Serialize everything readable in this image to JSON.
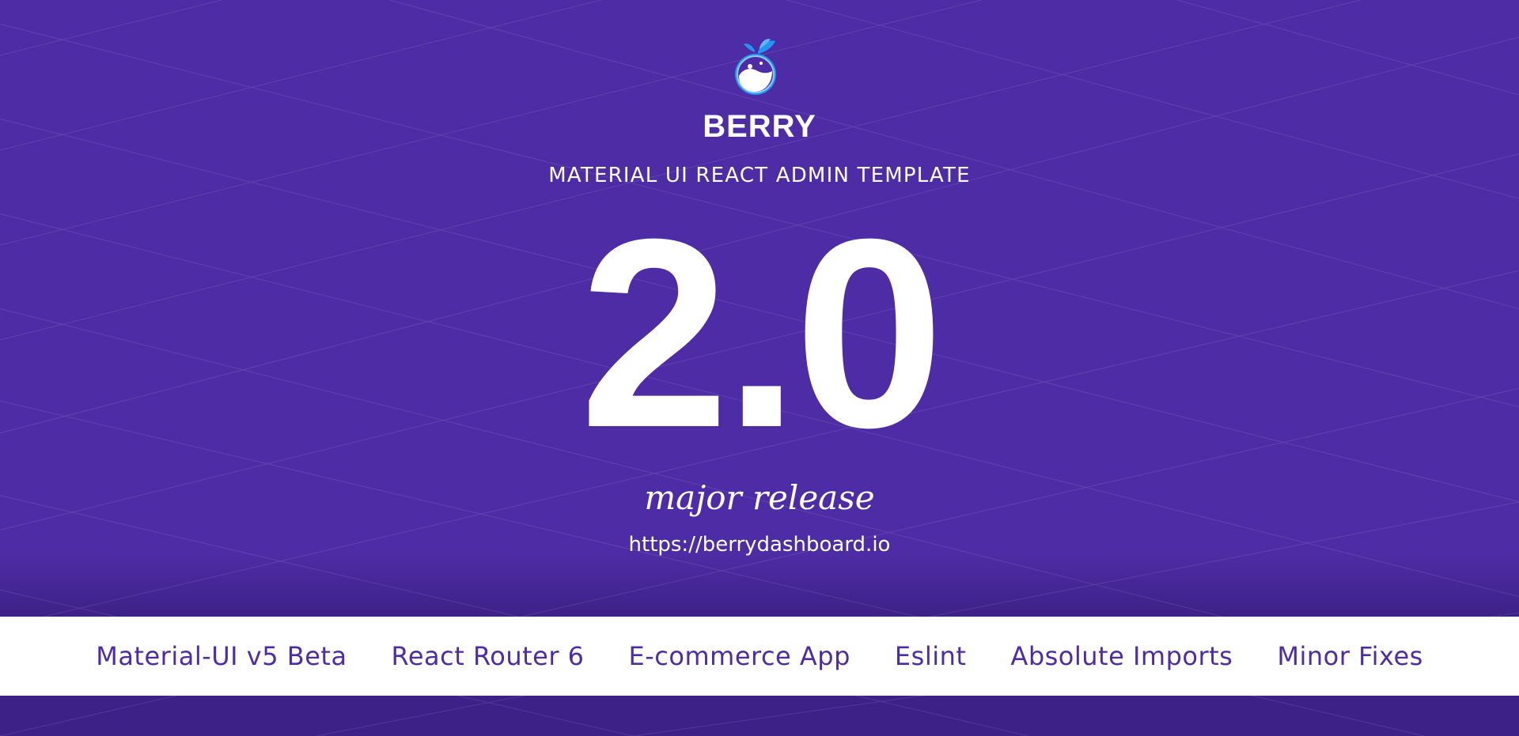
{
  "brand": {
    "name": "BERRY",
    "tagline": "MATERIAL UI REACT ADMIN TEMPLATE",
    "logo_icon": "berry-logo-icon"
  },
  "hero": {
    "version": "2.0",
    "release_label": "major release",
    "url": "https://berrydashboard.io"
  },
  "features": [
    "Material-UI v5 Beta",
    "React Router 6",
    "E-commerce App",
    "Eslint",
    "Absolute Imports",
    "Minor Fixes"
  ],
  "colors": {
    "background": "#4e2ca5",
    "text": "#ffffff",
    "feature_text": "#4e2ca5",
    "logo_blue": "#2196f3"
  }
}
